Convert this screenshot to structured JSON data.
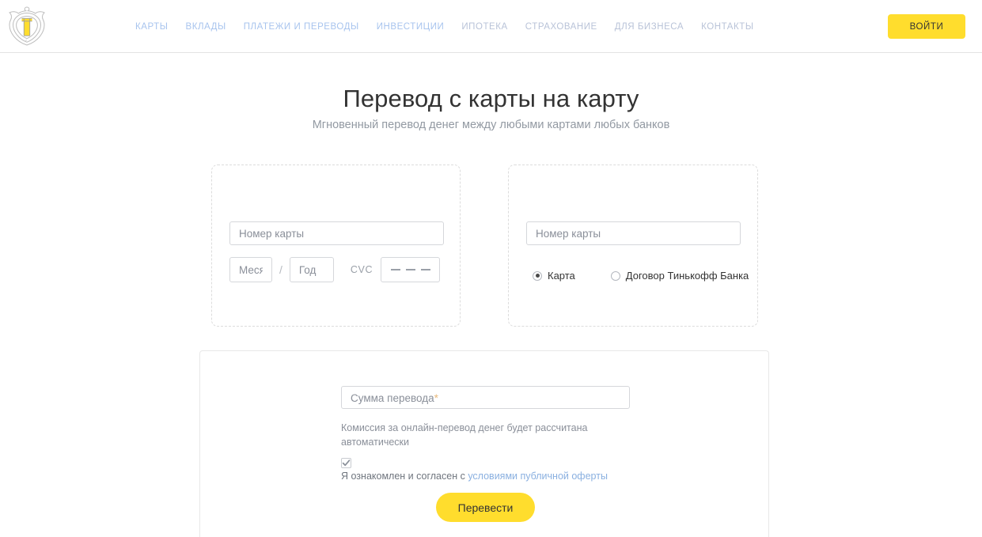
{
  "header": {
    "logo_name": "tinkoff-shield-logo",
    "nav": [
      {
        "label": "КАРТЫ",
        "dim": false
      },
      {
        "label": "ВКЛАДЫ",
        "dim": false
      },
      {
        "label": "ПЛАТЕЖИ И ПЕРЕВОДЫ",
        "dim": false
      },
      {
        "label": "ИНВЕСТИЦИИ",
        "dim": false
      },
      {
        "label": "ИПОТЕКА",
        "dim": true
      },
      {
        "label": "СТРАХОВАНИЕ",
        "dim": true
      },
      {
        "label": "ДЛЯ БИЗНЕСА",
        "dim": true
      },
      {
        "label": "КОНТАКТЫ",
        "dim": true
      }
    ],
    "login_label": "ВОЙТИ",
    "accent_color": "#ffdd2d",
    "nav_link_color": "#a8c4ee"
  },
  "hero": {
    "title": "Перевод с карты на карту",
    "subtitle": "Мгновенный перевод денег между любыми картами любых банков"
  },
  "transfer": {
    "separator_icon": "chevron-right-icon",
    "from": {
      "card_number_placeholder": "Номер карты",
      "card_number_value": "",
      "month_placeholder": "Месяц",
      "month_value": "",
      "separator": "/",
      "year_placeholder": "Год",
      "year_value": "",
      "cvc_label": "CVC",
      "cvc_value": ""
    },
    "to": {
      "card_number_placeholder": "Номер карты",
      "card_number_value": "",
      "options": [
        {
          "label": "Карта",
          "checked": true
        },
        {
          "label": "Договор Тинькофф Банка",
          "checked": false
        }
      ]
    }
  },
  "form": {
    "amount_placeholder": "Сумма перевода",
    "amount_required_marker": "*",
    "amount_value": "",
    "fee_note": "Комиссия за онлайн-перевод денег будет рассчитана автоматически",
    "agree_checked": true,
    "agree_text": "Я ознакомлен и согласен с ",
    "agree_link": "условиями публичной оферты",
    "submit_label": "Перевести",
    "submit_color": "#ffdd2d",
    "link_color": "#8ab0e0"
  }
}
